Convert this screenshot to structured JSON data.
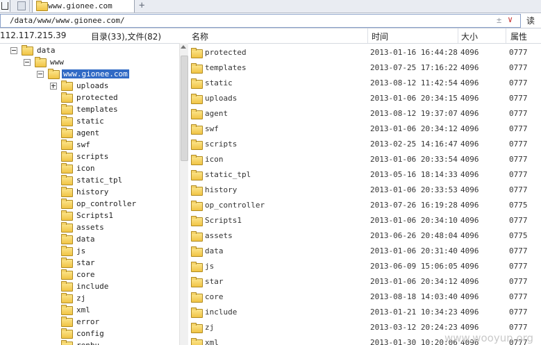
{
  "tab": {
    "title": "www.gionee.com",
    "add_label": "+"
  },
  "address": {
    "path": "/data/www/www.gionee.com/",
    "plus": "±",
    "dropdown": "∨",
    "read_label": "读"
  },
  "status": {
    "ip": "112.117.215.39",
    "counts": "目录(33),文件(82)"
  },
  "columns": {
    "name": "名称",
    "time": "时间",
    "size": "大小",
    "attr": "属性"
  },
  "tree": [
    {
      "label": "data",
      "depth": 0,
      "expander": "minus"
    },
    {
      "label": "www",
      "depth": 1,
      "expander": "minus"
    },
    {
      "label": "www.gionee.com",
      "depth": 2,
      "expander": "minus",
      "selected": true
    },
    {
      "label": "uploads",
      "depth": 3,
      "expander": "plus"
    },
    {
      "label": "protected",
      "depth": 3
    },
    {
      "label": "templates",
      "depth": 3
    },
    {
      "label": "static",
      "depth": 3
    },
    {
      "label": "agent",
      "depth": 3
    },
    {
      "label": "swf",
      "depth": 3
    },
    {
      "label": "scripts",
      "depth": 3
    },
    {
      "label": "icon",
      "depth": 3
    },
    {
      "label": "static_tpl",
      "depth": 3
    },
    {
      "label": "history",
      "depth": 3
    },
    {
      "label": "op_controller",
      "depth": 3
    },
    {
      "label": "Scripts1",
      "depth": 3
    },
    {
      "label": "assets",
      "depth": 3
    },
    {
      "label": "data",
      "depth": 3
    },
    {
      "label": "js",
      "depth": 3
    },
    {
      "label": "star",
      "depth": 3
    },
    {
      "label": "core",
      "depth": 3
    },
    {
      "label": "include",
      "depth": 3
    },
    {
      "label": "zj",
      "depth": 3
    },
    {
      "label": "xml",
      "depth": 3
    },
    {
      "label": "error",
      "depth": 3
    },
    {
      "label": "config",
      "depth": 3
    },
    {
      "label": "renbu",
      "depth": 3
    }
  ],
  "files": [
    {
      "name": "protected",
      "time": "2013-01-16 16:44:28",
      "size": "4096",
      "attr": "0777"
    },
    {
      "name": "templates",
      "time": "2013-07-25 17:16:22",
      "size": "4096",
      "attr": "0777"
    },
    {
      "name": "static",
      "time": "2013-08-12 11:42:54",
      "size": "4096",
      "attr": "0777"
    },
    {
      "name": "uploads",
      "time": "2013-01-06 20:34:15",
      "size": "4096",
      "attr": "0777"
    },
    {
      "name": "agent",
      "time": "2013-08-12 19:37:07",
      "size": "4096",
      "attr": "0777"
    },
    {
      "name": "swf",
      "time": "2013-01-06 20:34:12",
      "size": "4096",
      "attr": "0777"
    },
    {
      "name": "scripts",
      "time": "2013-02-25 14:16:47",
      "size": "4096",
      "attr": "0777"
    },
    {
      "name": "icon",
      "time": "2013-01-06 20:33:54",
      "size": "4096",
      "attr": "0777"
    },
    {
      "name": "static_tpl",
      "time": "2013-05-16 18:14:33",
      "size": "4096",
      "attr": "0777"
    },
    {
      "name": "history",
      "time": "2013-01-06 20:33:53",
      "size": "4096",
      "attr": "0777"
    },
    {
      "name": "op_controller",
      "time": "2013-07-26 16:19:28",
      "size": "4096",
      "attr": "0775"
    },
    {
      "name": "Scripts1",
      "time": "2013-01-06 20:34:10",
      "size": "4096",
      "attr": "0777"
    },
    {
      "name": "assets",
      "time": "2013-06-26 20:48:04",
      "size": "4096",
      "attr": "0775"
    },
    {
      "name": "data",
      "time": "2013-01-06 20:31:40",
      "size": "4096",
      "attr": "0777"
    },
    {
      "name": "js",
      "time": "2013-06-09 15:06:05",
      "size": "4096",
      "attr": "0777"
    },
    {
      "name": "star",
      "time": "2013-01-06 20:34:12",
      "size": "4096",
      "attr": "0777"
    },
    {
      "name": "core",
      "time": "2013-08-18 14:03:40",
      "size": "4096",
      "attr": "0777"
    },
    {
      "name": "include",
      "time": "2013-01-21 10:34:23",
      "size": "4096",
      "attr": "0777"
    },
    {
      "name": "zj",
      "time": "2013-03-12 20:24:23",
      "size": "4096",
      "attr": "0777"
    },
    {
      "name": "xml",
      "time": "2013-01-30 10:20:06",
      "size": "4096",
      "attr": "0777"
    }
  ],
  "watermark": "www.wooyun.org",
  "colors": {
    "selection": "#316ac5",
    "folder": "#f1c445"
  }
}
